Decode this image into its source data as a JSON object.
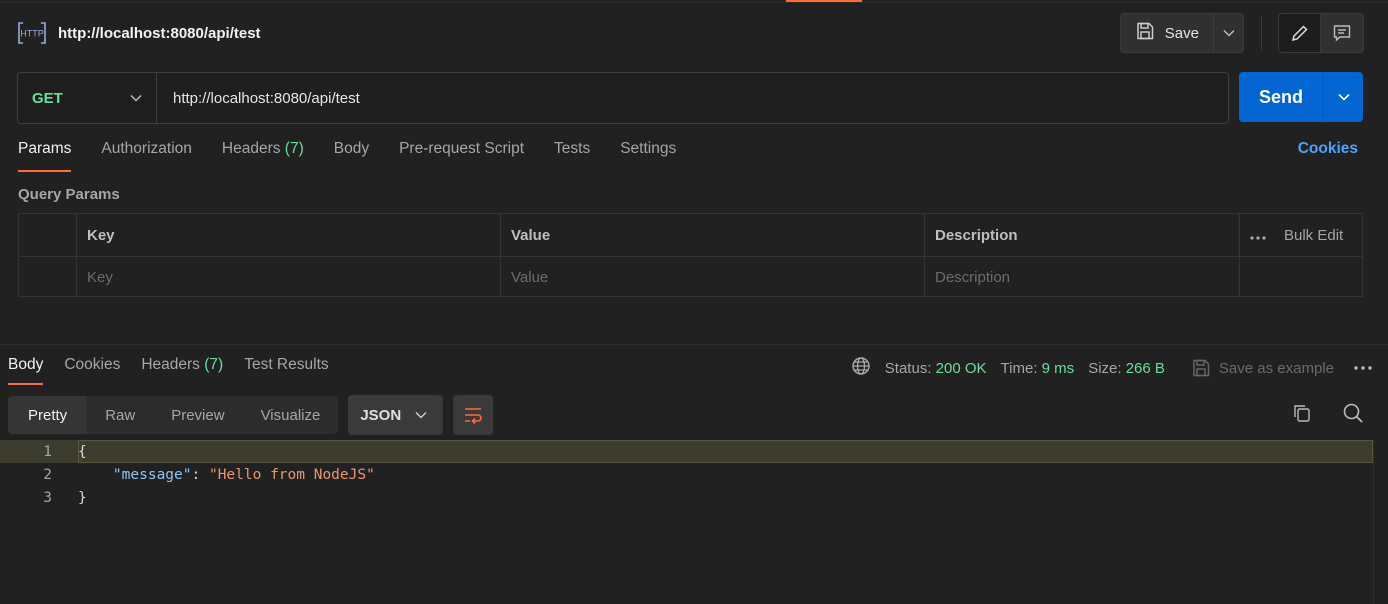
{
  "header": {
    "title": "http://localhost:8080/api/test",
    "save_label": "Save"
  },
  "request": {
    "method": "GET",
    "url": "http://localhost:8080/api/test",
    "send_label": "Send"
  },
  "request_tabs": {
    "params": "Params",
    "authorization": "Authorization",
    "headers": "Headers",
    "headers_count": "(7)",
    "body": "Body",
    "prerequest": "Pre-request Script",
    "tests": "Tests",
    "settings": "Settings",
    "cookies": "Cookies"
  },
  "query_params": {
    "label": "Query Params",
    "columns": {
      "key": "Key",
      "value": "Value",
      "description": "Description",
      "bulk_edit": "Bulk Edit"
    },
    "placeholders": {
      "key": "Key",
      "value": "Value",
      "description": "Description"
    }
  },
  "response": {
    "tabs": {
      "body": "Body",
      "cookies": "Cookies",
      "headers": "Headers",
      "headers_count": "(7)",
      "test_results": "Test Results"
    },
    "status_label": "Status:",
    "status_value": "200 OK",
    "time_label": "Time:",
    "time_value": "9 ms",
    "size_label": "Size:",
    "size_value": "266 B",
    "save_example": "Save as example",
    "views": {
      "pretty": "Pretty",
      "raw": "Raw",
      "preview": "Preview",
      "visualize": "Visualize"
    },
    "format": "JSON",
    "code": {
      "line_numbers": [
        "1",
        "2",
        "3"
      ],
      "open_brace": "{",
      "key": "\"message\"",
      "colon": ": ",
      "value": "\"Hello from NodeJS\"",
      "close_brace": "}"
    }
  },
  "colors": {
    "accent": "#ff6c37",
    "send": "#0265d2",
    "success": "#6bdd9a",
    "link": "#4ca2ff"
  }
}
